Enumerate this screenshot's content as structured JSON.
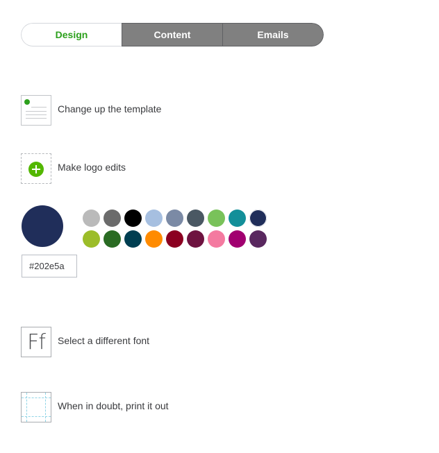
{
  "tabs": [
    {
      "label": "Design",
      "active": true
    },
    {
      "label": "Content",
      "active": false
    },
    {
      "label": "Emails",
      "active": false
    }
  ],
  "options": {
    "template": {
      "label": "Change up the template",
      "icon": "template-icon"
    },
    "logo": {
      "label": "Make logo edits",
      "icon": "add-logo-icon"
    },
    "font": {
      "label": "Select a different font",
      "icon": "font-icon",
      "glyph": "Ff"
    },
    "print": {
      "label": "When in doubt, print it out",
      "icon": "print-margins-icon"
    }
  },
  "color": {
    "selected": "#202e5a",
    "hex_value": "#202e5a",
    "palette_row1": [
      "#bababa",
      "#6b6b6b",
      "#000000",
      "#a6bfe0",
      "#7b8aa5",
      "#4a5863",
      "#79c25a",
      "#138f99",
      "#202e5a"
    ],
    "palette_row2": [
      "#9cbd29",
      "#2a6b23",
      "#003e51",
      "#ff8b00",
      "#8b0021",
      "#6e1340",
      "#f47aa0",
      "#a10070",
      "#59285f"
    ]
  },
  "accent": "#2ca01c"
}
